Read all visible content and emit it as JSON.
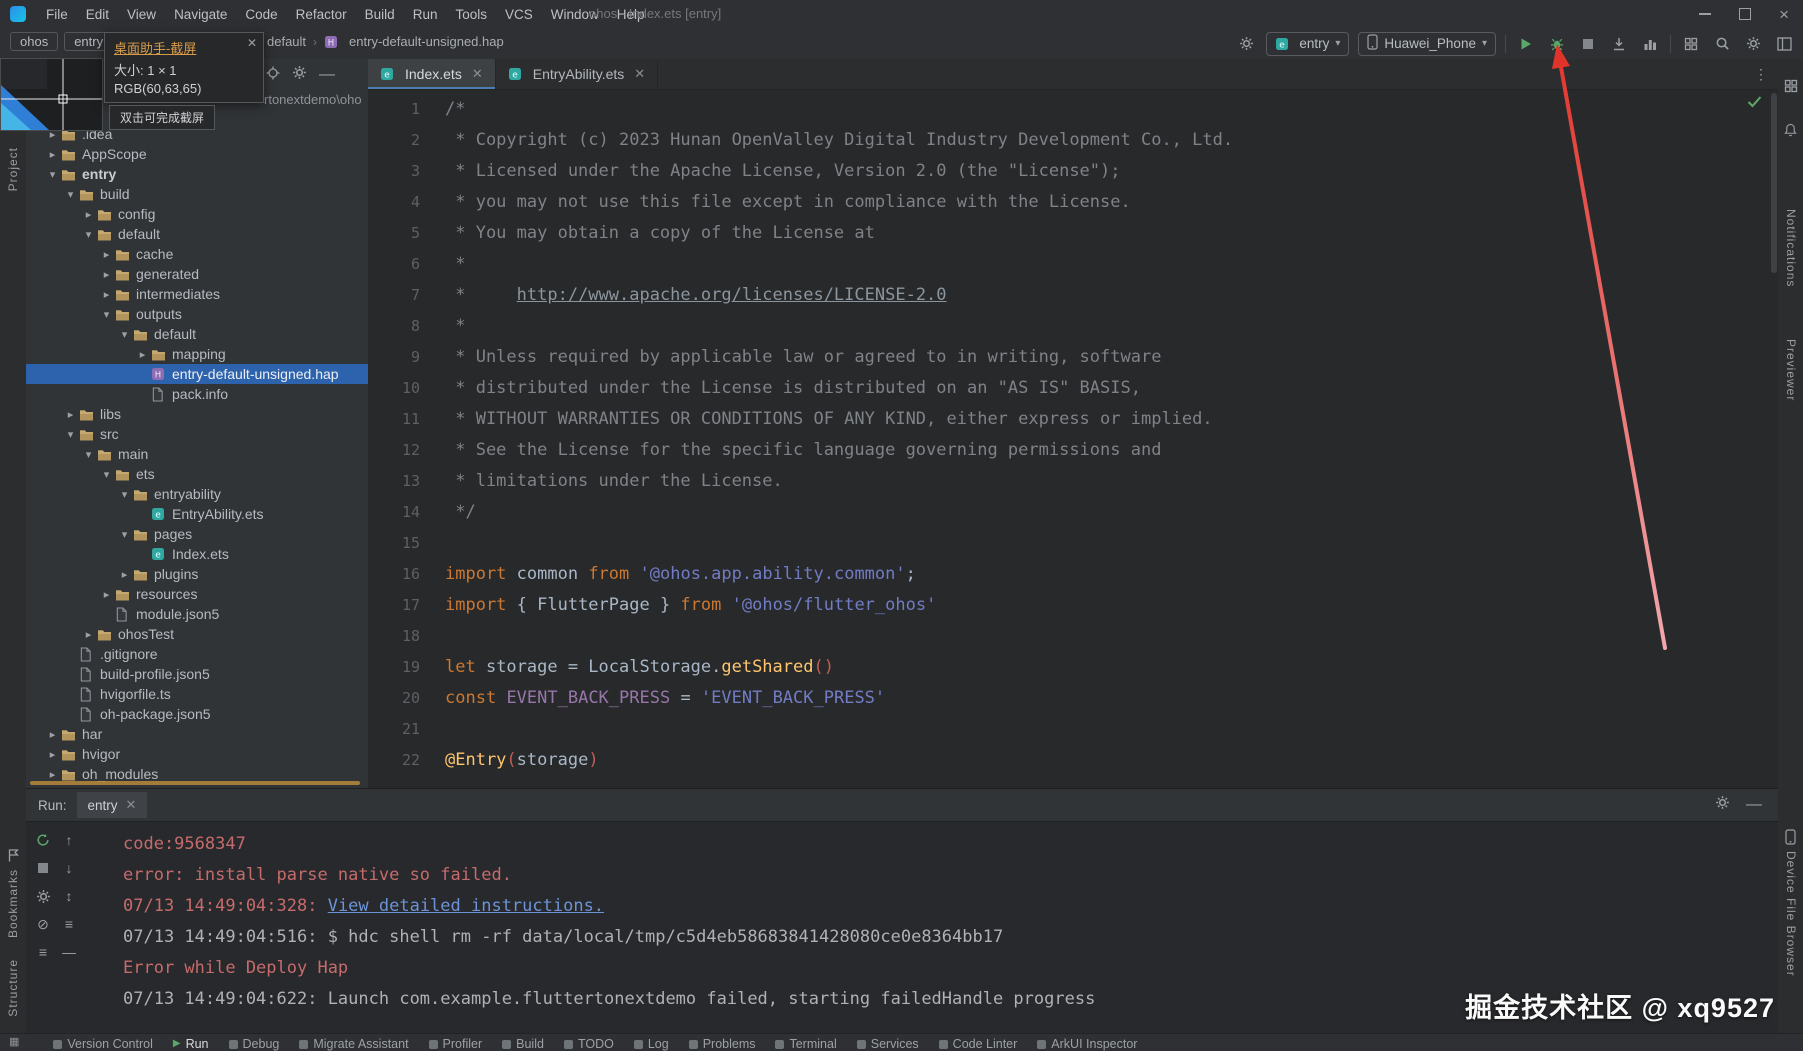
{
  "window": {
    "title": "ohos - Index.ets [entry]"
  },
  "menu": {
    "items": [
      "File",
      "Edit",
      "View",
      "Navigate",
      "Code",
      "Refactor",
      "Build",
      "Run",
      "Tools",
      "VCS",
      "Window",
      "Help"
    ]
  },
  "breadcrumbs": {
    "left": [
      "ohos",
      "entry"
    ],
    "right_parent": "default",
    "right_file": "entry-default-unsigned.hap"
  },
  "toolbar": {
    "run_config": "entry",
    "device": "Huawei_Phone"
  },
  "capture_overlay": {
    "title": "桌面助手-截屏",
    "size": "大小: 1 × 1",
    "rgb": "RGB(60,63,65)",
    "hint": "双击可完成截屏"
  },
  "project": {
    "root_path_fragment": "rtonextdemo\\oho",
    "tree": [
      {
        "label": ".idea",
        "indent": 1,
        "chevron": "collapsed",
        "icon": "folder-icon"
      },
      {
        "label": "AppScope",
        "indent": 1,
        "chevron": "collapsed",
        "icon": "folder-icon"
      },
      {
        "label": "entry",
        "indent": 1,
        "chevron": "expanded",
        "icon": "folder-icon",
        "bold": true
      },
      {
        "label": "build",
        "indent": 2,
        "chevron": "expanded",
        "icon": "folder-icon"
      },
      {
        "label": "config",
        "indent": 3,
        "chevron": "collapsed",
        "icon": "folder-icon"
      },
      {
        "label": "default",
        "indent": 3,
        "chevron": "expanded",
        "icon": "folder-icon"
      },
      {
        "label": "cache",
        "indent": 4,
        "chevron": "collapsed",
        "icon": "folder-icon"
      },
      {
        "label": "generated",
        "indent": 4,
        "chevron": "collapsed",
        "icon": "folder-icon"
      },
      {
        "label": "intermediates",
        "indent": 4,
        "chevron": "collapsed",
        "icon": "folder-icon"
      },
      {
        "label": "outputs",
        "indent": 4,
        "chevron": "expanded",
        "icon": "folder-icon"
      },
      {
        "label": "default",
        "indent": 5,
        "chevron": "expanded",
        "icon": "folder-icon"
      },
      {
        "label": "mapping",
        "indent": 6,
        "chevron": "collapsed",
        "icon": "folder-icon"
      },
      {
        "label": "entry-default-unsigned.hap",
        "indent": 6,
        "chevron": "",
        "icon": "hap-icon",
        "selected": true
      },
      {
        "label": "pack.info",
        "indent": 6,
        "chevron": "",
        "icon": "doc-icon"
      },
      {
        "label": "libs",
        "indent": 2,
        "chevron": "collapsed",
        "icon": "folder-icon"
      },
      {
        "label": "src",
        "indent": 2,
        "chevron": "expanded",
        "icon": "folder-icon"
      },
      {
        "label": "main",
        "indent": 3,
        "chevron": "expanded",
        "icon": "folder-icon"
      },
      {
        "label": "ets",
        "indent": 4,
        "chevron": "expanded",
        "icon": "folder-icon"
      },
      {
        "label": "entryability",
        "indent": 5,
        "chevron": "expanded",
        "icon": "folder-icon"
      },
      {
        "label": "EntryAbility.ets",
        "indent": 6,
        "chevron": "",
        "icon": "ets-icon"
      },
      {
        "label": "pages",
        "indent": 5,
        "chevron": "expanded",
        "icon": "folder-icon"
      },
      {
        "label": "Index.ets",
        "indent": 6,
        "chevron": "",
        "icon": "ets-icon"
      },
      {
        "label": "plugins",
        "indent": 5,
        "chevron": "collapsed",
        "icon": "folder-icon"
      },
      {
        "label": "resources",
        "indent": 4,
        "chevron": "collapsed",
        "icon": "folder-icon"
      },
      {
        "label": "module.json5",
        "indent": 4,
        "chevron": "",
        "icon": "doc-icon"
      },
      {
        "label": "ohosTest",
        "indent": 3,
        "chevron": "collapsed",
        "icon": "folder-icon"
      },
      {
        "label": ".gitignore",
        "indent": 2,
        "chevron": "",
        "icon": "doc-icon"
      },
      {
        "label": "build-profile.json5",
        "indent": 2,
        "chevron": "",
        "icon": "doc-icon"
      },
      {
        "label": "hvigorfile.ts",
        "indent": 2,
        "chevron": "",
        "icon": "doc-icon"
      },
      {
        "label": "oh-package.json5",
        "indent": 2,
        "chevron": "",
        "icon": "doc-icon"
      },
      {
        "label": "har",
        "indent": 1,
        "chevron": "collapsed",
        "icon": "folder-icon"
      },
      {
        "label": "hvigor",
        "indent": 1,
        "chevron": "collapsed",
        "icon": "folder-icon"
      },
      {
        "label": "oh_modules",
        "indent": 1,
        "chevron": "collapsed",
        "icon": "folder-icon"
      }
    ]
  },
  "editor": {
    "tabs": [
      {
        "label": "Index.ets",
        "active": true
      },
      {
        "label": "EntryAbility.ets",
        "active": false
      }
    ],
    "lines": [
      {
        "n": 1,
        "seg": [
          [
            "cmt",
            "/*"
          ]
        ]
      },
      {
        "n": 2,
        "seg": [
          [
            "cmt",
            " * Copyright (c) 2023 Hunan OpenValley Digital Industry Development Co., Ltd."
          ]
        ]
      },
      {
        "n": 3,
        "seg": [
          [
            "cmt",
            " * Licensed under the Apache License, Version 2.0 (the \"License\");"
          ]
        ]
      },
      {
        "n": 4,
        "seg": [
          [
            "cmt",
            " * you may not use this file except in compliance with the License."
          ]
        ]
      },
      {
        "n": 5,
        "seg": [
          [
            "cmt",
            " * You may obtain a copy of the License at"
          ]
        ]
      },
      {
        "n": 6,
        "seg": [
          [
            "cmt",
            " *"
          ]
        ]
      },
      {
        "n": 7,
        "seg": [
          [
            "cmt",
            " *     "
          ],
          [
            "lnk",
            "http://www.apache.org/licenses/LICENSE-2.0"
          ]
        ]
      },
      {
        "n": 8,
        "seg": [
          [
            "cmt",
            " *"
          ]
        ]
      },
      {
        "n": 9,
        "seg": [
          [
            "cmt",
            " * Unless required by applicable law or agreed to in writing, software"
          ]
        ]
      },
      {
        "n": 10,
        "seg": [
          [
            "cmt",
            " * distributed under the License is distributed on an \"AS IS\" BASIS,"
          ]
        ]
      },
      {
        "n": 11,
        "seg": [
          [
            "cmt",
            " * WITHOUT WARRANTIES OR CONDITIONS OF ANY KIND, either express or implied."
          ]
        ]
      },
      {
        "n": 12,
        "seg": [
          [
            "cmt",
            " * See the License for the specific language governing permissions and"
          ]
        ]
      },
      {
        "n": 13,
        "seg": [
          [
            "cmt",
            " * limitations under the License."
          ]
        ]
      },
      {
        "n": 14,
        "seg": [
          [
            "cmt",
            " */"
          ]
        ]
      },
      {
        "n": 15,
        "seg": []
      },
      {
        "n": 16,
        "seg": [
          [
            "kw",
            "import"
          ],
          [
            "pln",
            " common "
          ],
          [
            "kw",
            "from"
          ],
          [
            "pln",
            " "
          ],
          [
            "str",
            "'@ohos.app.ability.common'"
          ],
          [
            "pln",
            ";"
          ]
        ]
      },
      {
        "n": 17,
        "seg": [
          [
            "kw",
            "import"
          ],
          [
            "pln",
            " { FlutterPage } "
          ],
          [
            "kw",
            "from"
          ],
          [
            "pln",
            " "
          ],
          [
            "str",
            "'@ohos/flutter_ohos'"
          ]
        ]
      },
      {
        "n": 18,
        "seg": []
      },
      {
        "n": 19,
        "seg": [
          [
            "kw",
            "let"
          ],
          [
            "pln",
            " storage = LocalStorage."
          ],
          [
            "fn",
            "getShared"
          ],
          [
            "par",
            "()"
          ]
        ]
      },
      {
        "n": 20,
        "seg": [
          [
            "kw",
            "const"
          ],
          [
            "pln",
            " "
          ],
          [
            "cst",
            "EVENT_BACK_PRESS"
          ],
          [
            "pln",
            " = "
          ],
          [
            "str",
            "'EVENT_BACK_PRESS'"
          ]
        ]
      },
      {
        "n": 21,
        "seg": []
      },
      {
        "n": 22,
        "seg": [
          [
            "ann",
            "@Entry"
          ],
          [
            "par",
            "("
          ],
          [
            "pln",
            "storage"
          ],
          [
            "par",
            ")"
          ]
        ]
      }
    ]
  },
  "console": {
    "label": "Run:",
    "tab": "entry",
    "lines": [
      {
        "seg": [
          [
            "err",
            "code:9568347"
          ]
        ]
      },
      {
        "seg": [
          [
            "err",
            "error: install parse native so failed."
          ]
        ]
      },
      {
        "seg": [
          [
            "err",
            "07/13 14:49:04:328: "
          ],
          [
            "lnk",
            "View detailed instructions."
          ]
        ]
      },
      {
        "seg": [
          [
            "inf",
            "07/13 14:49:04:516: $ hdc shell rm -rf data/local/tmp/c5d4eb58683841428080ce0e8364bb17"
          ]
        ]
      },
      {
        "seg": [
          [
            "err",
            "Error while Deploy Hap"
          ]
        ]
      },
      {
        "seg": [
          [
            "inf",
            "07/13 14:49:04:622: Launch com.example.fluttertonextdemo failed, starting failedHandle progress"
          ]
        ]
      }
    ]
  },
  "statusbar": {
    "items": [
      {
        "label": "Version Control"
      },
      {
        "label": "Run",
        "active": true
      },
      {
        "label": "Debug"
      },
      {
        "label": "Migrate Assistant"
      },
      {
        "label": "Profiler"
      },
      {
        "label": "Build"
      },
      {
        "label": "TODO"
      },
      {
        "label": "Log"
      },
      {
        "label": "Problems"
      },
      {
        "label": "Terminal"
      },
      {
        "label": "Services"
      },
      {
        "label": "Code Linter"
      },
      {
        "label": "ArkUI Inspector"
      }
    ]
  },
  "strips": {
    "left": [
      "Project",
      "Bookmarks",
      "Structure"
    ],
    "right": [
      "Notifications",
      "Previewer",
      "Device File Browser"
    ]
  },
  "watermark": "掘金技术社区 @ xq9527",
  "icons": {
    "folder-icon": "tan folder shape",
    "doc-icon": "gray document outline",
    "hap-icon": "violet package square",
    "ets-icon": "teal ets file square",
    "run-icon": "green play triangle",
    "debug-icon": "green bug",
    "search-icon": "magnifier",
    "settings-icon": "gear"
  },
  "colors": {
    "selection_blue": "#2d63ad",
    "run_green": "#59a869",
    "error_red": "#c56b6b",
    "arrow_red": "#e0342b"
  }
}
